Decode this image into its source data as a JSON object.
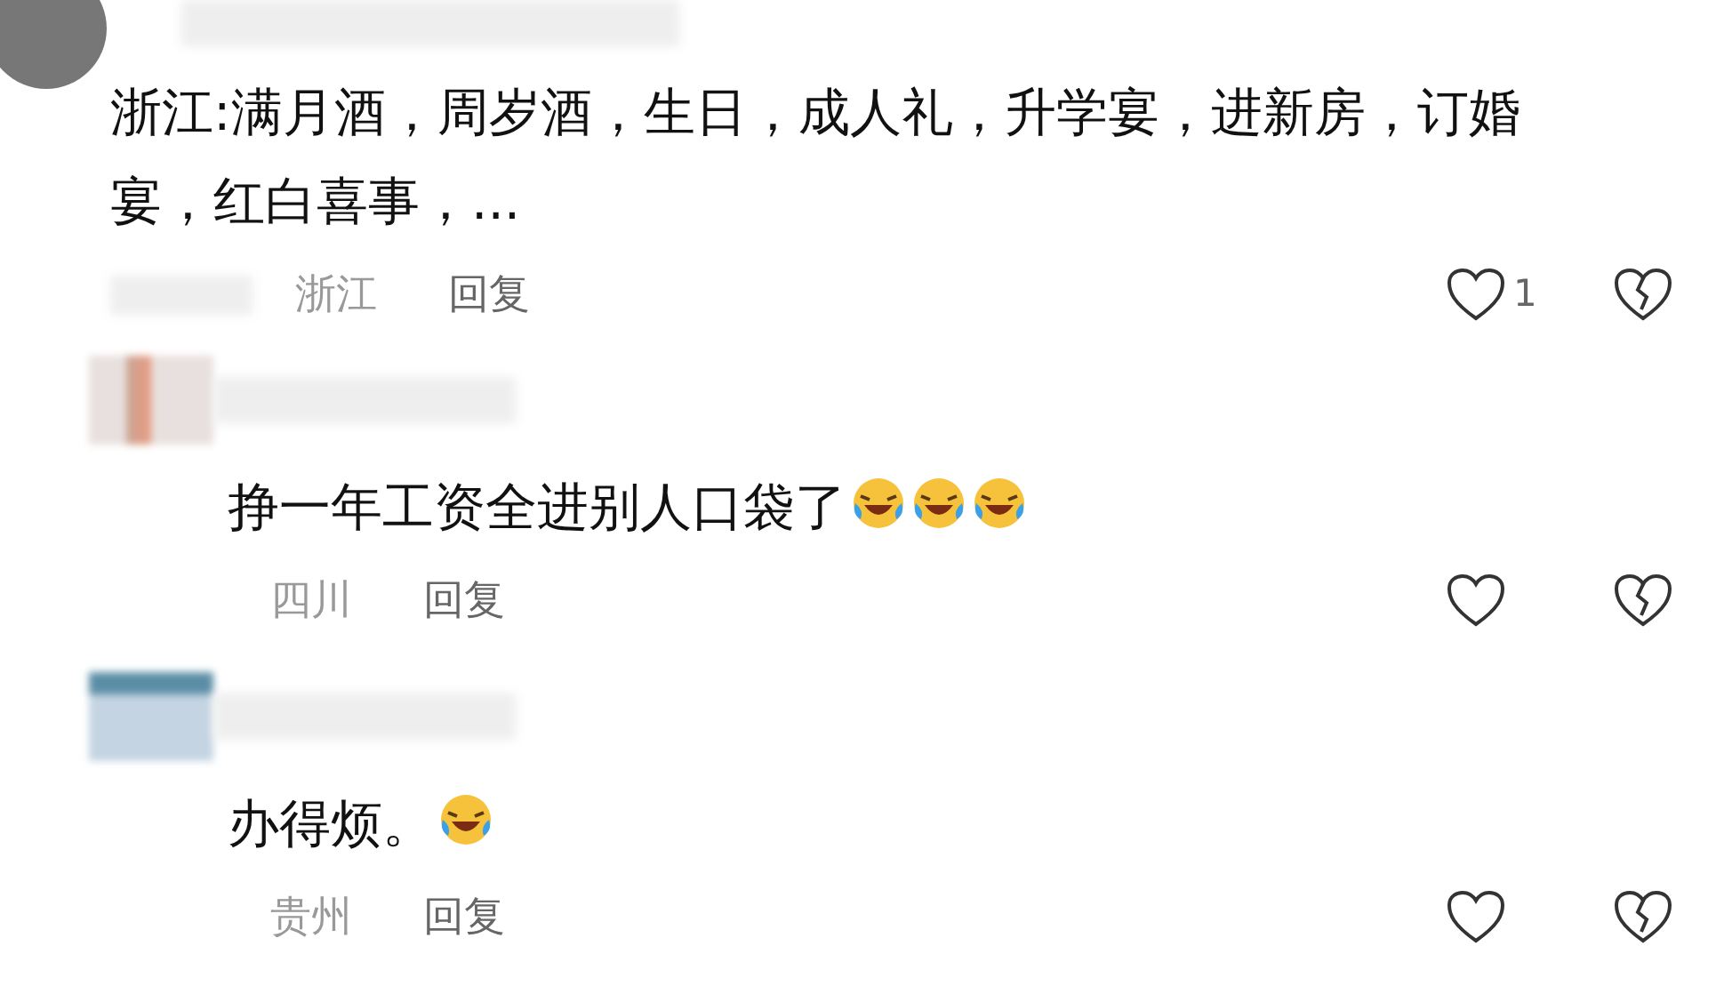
{
  "comments": [
    {
      "text": "浙江:满月酒，周岁酒，生日，成人礼，升学宴，进新房，订婚宴，红白喜事，...",
      "location": "浙江",
      "reply": "回复",
      "likes": "1",
      "kind": "top"
    },
    {
      "text": "挣一年工资全进别人口袋了",
      "emoji": [
        {
          "kind": "laughing-crying"
        },
        {
          "kind": "laughing-crying"
        },
        {
          "kind": "laughing-crying"
        }
      ],
      "location": "四川",
      "reply": "回复",
      "kind": "reply"
    },
    {
      "text": "办得烦。",
      "emoji": [
        {
          "kind": "laughing-crying"
        }
      ],
      "location": "贵州",
      "reply": "回复",
      "kind": "reply"
    }
  ]
}
